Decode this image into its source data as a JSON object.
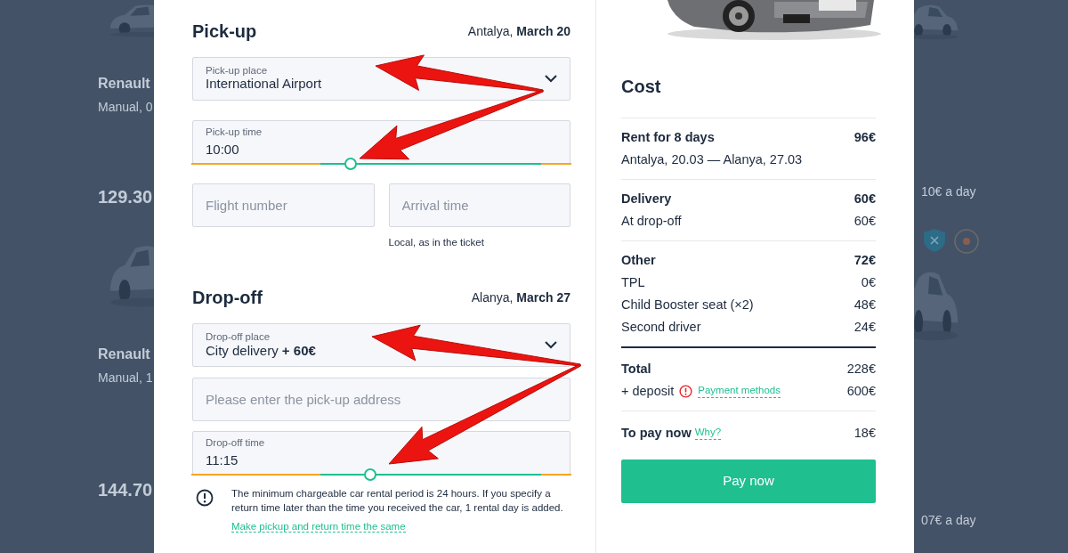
{
  "background_left": [
    {
      "title": "Renault",
      "subtitle": "Manual, 0",
      "price": "129.30"
    },
    {
      "title": "Renault",
      "subtitle": "Manual, 1",
      "price": "144.70"
    }
  ],
  "background_right": [
    {
      "text": "10€ a day"
    },
    {
      "text": "07€ a day"
    }
  ],
  "pickup": {
    "title": "Pick-up",
    "city": "Antalya,",
    "date": "March 20",
    "place_field": {
      "label": "Pick-up place",
      "value": "International Airport"
    },
    "time_field": {
      "label": "Pick-up time",
      "value": "10:00",
      "level": 0.42
    },
    "extra_fields": [
      {
        "placeholder": "Flight number"
      },
      {
        "placeholder": "Arrival time"
      }
    ],
    "hint": "Local, as in the ticket"
  },
  "dropoff": {
    "title": "Drop-off",
    "city": "Alanya,",
    "date": "March 27",
    "place_field": {
      "label": "Drop-off place",
      "value": "City delivery **+ 60€**"
    },
    "address_field": {
      "placeholder": "Please enter the pick-up address"
    },
    "time_field": {
      "label": "Drop-off time",
      "value": "11:15",
      "level": 0.47
    },
    "note": "The minimum chargeable car rental period is 24 hours. If you specify a return time later than the time you received the car, 1 rental day is added.",
    "note_link": "Make pickup and return time the same"
  },
  "cost": {
    "title": "Cost",
    "groups": [
      {
        "rows": [
          {
            "kind": "header",
            "label": "Rent for 8 days",
            "value": "96€"
          },
          {
            "kind": "detail",
            "label": "Antalya, 20.03 — Alanya, 27.03"
          }
        ]
      },
      {
        "rows": [
          {
            "kind": "header",
            "label": "Delivery",
            "value": "60€"
          },
          {
            "kind": "detail",
            "label": "At drop-off",
            "value": "60€"
          }
        ]
      },
      {
        "rows": [
          {
            "kind": "header",
            "label": "Other",
            "value": "72€"
          },
          {
            "kind": "detail",
            "label": "TPL",
            "value": "0€"
          },
          {
            "kind": "detail",
            "label": "Child Booster seat (×2)",
            "value": "48€"
          },
          {
            "kind": "detail",
            "label": "Second driver",
            "value": "24€"
          }
        ]
      }
    ],
    "total": {
      "label": "Total",
      "value": "228€",
      "deposit_label": "+ deposit",
      "deposit_link": "Payment methods",
      "deposit_value": "600€"
    },
    "pay_now": {
      "label": "To pay now",
      "link": "Why?",
      "value": "18€"
    },
    "button": "Pay now"
  }
}
